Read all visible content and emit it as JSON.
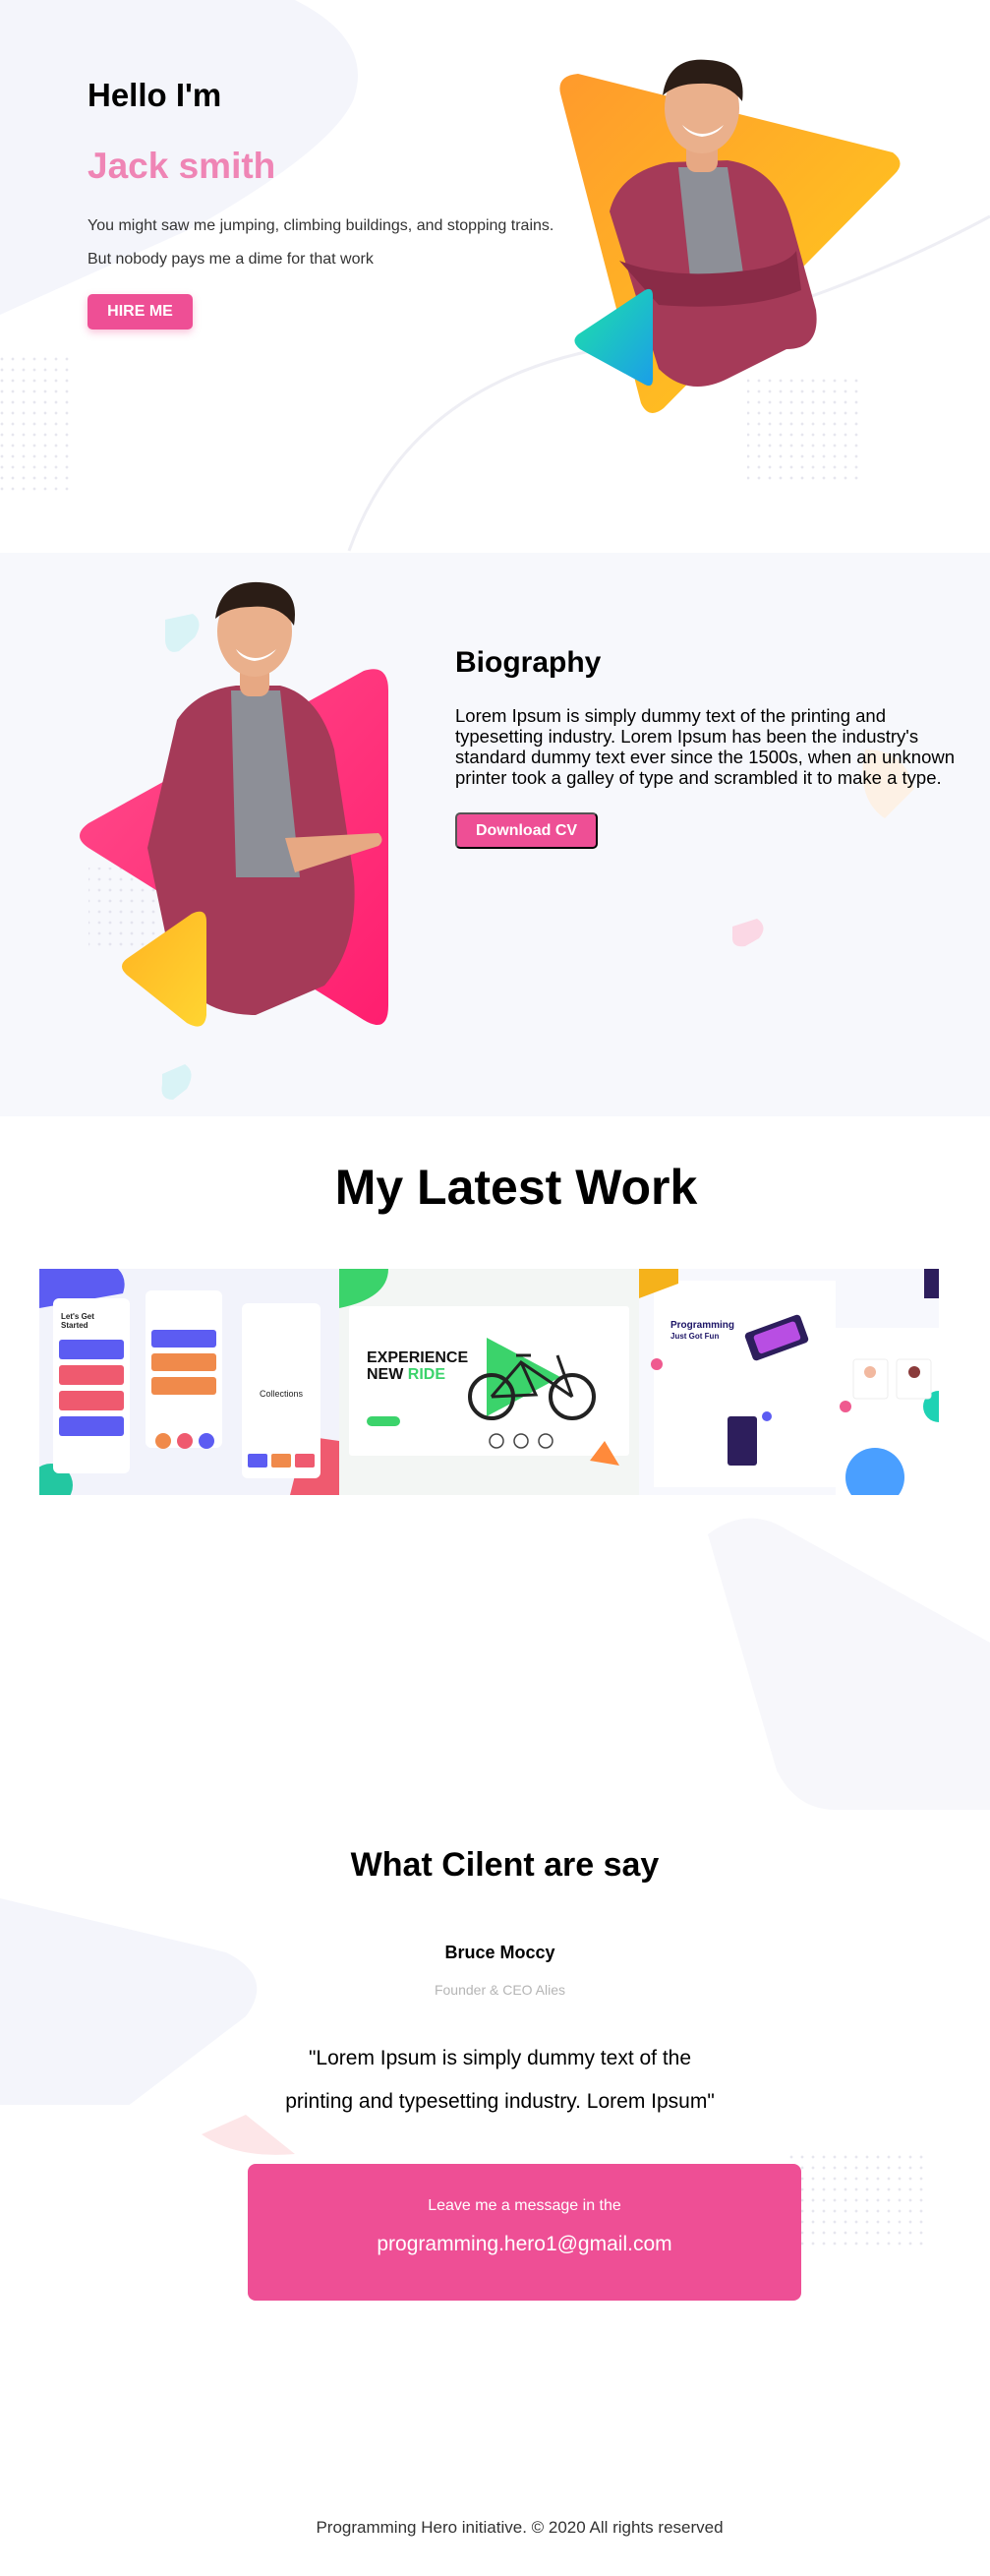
{
  "hero": {
    "greeting": "Hello I'm",
    "name": "Jack smith",
    "line1": "You might saw me jumping, climbing buildings, and stopping trains.",
    "line2": "But nobody pays me a dime for that work",
    "button": "HIRE ME"
  },
  "bio": {
    "title": "Biography",
    "text": "Lorem Ipsum is simply dummy text of the printing and typesetting industry. Lorem Ipsum has been the industry's standard dummy text ever since the 1500s, when an unknown printer took a galley of type and scrambled it to make a type.",
    "button": "Download CV"
  },
  "work": {
    "title": "My Latest Work",
    "items": [
      {
        "title": "Let's Get Started",
        "status": "Collections"
      },
      {
        "title": "EXPERIENCE",
        "title2": "NEW",
        "highlight": "RIDE"
      },
      {
        "title": "Programming",
        "subtitle": "Just Got Fun"
      }
    ]
  },
  "testimonial": {
    "title": "What Cilent are say",
    "name": "Bruce Moccy",
    "role": "Founder & CEO Alies",
    "quote1": "\"Lorem Ipsum is simply dummy text of the",
    "quote2": "printing and typesetting industry. Lorem Ipsum\""
  },
  "contact": {
    "label": "Leave me a message in the",
    "email": "programming.hero1@gmail.com"
  },
  "footer": {
    "text": "Programming Hero initiative. © 2020 All rights reserved"
  },
  "colors": {
    "accent": "#ee4f95",
    "name_pink": "#ef85b5",
    "bio_bg": "#f7f8fc",
    "orange": "#ffb12b",
    "teal": "#1fd2b4"
  }
}
